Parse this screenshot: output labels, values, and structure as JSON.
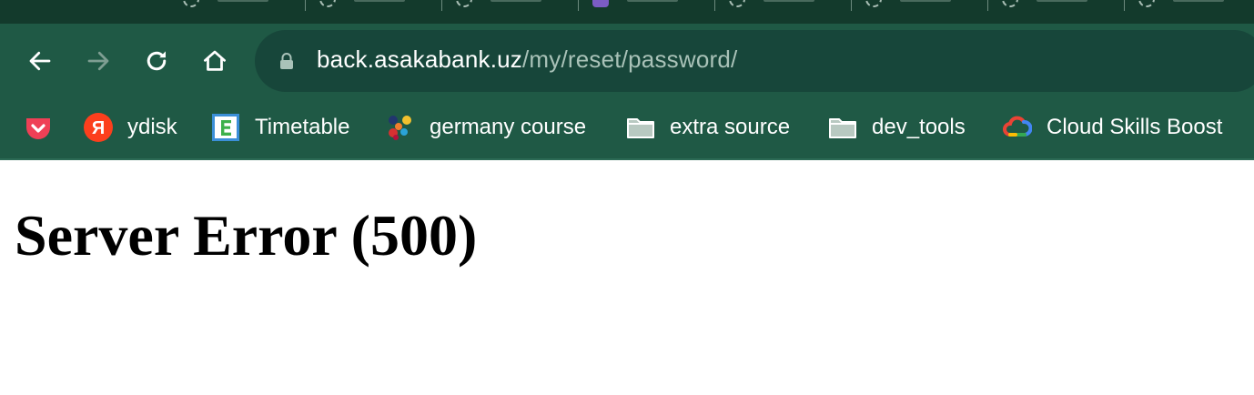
{
  "browser": {
    "tabs": [
      {
        "favicon": "loading-circle-icon"
      },
      {
        "favicon": "loading-circle-icon"
      },
      {
        "favicon": "loading-circle-icon"
      },
      {
        "favicon": "purple-app-icon"
      },
      {
        "favicon": "loading-circle-icon"
      },
      {
        "favicon": "loading-circle-icon"
      },
      {
        "favicon": "loading-circle-icon"
      },
      {
        "favicon": "loading-circle-icon"
      }
    ],
    "address": {
      "host": "back.asakabank.uz",
      "path": "/my/reset/password/"
    },
    "bookmarks": [
      {
        "label": "",
        "icon": "pocket-icon"
      },
      {
        "label": "ydisk",
        "icon": "yandex-icon"
      },
      {
        "label": "Timetable",
        "icon": "timetable-icon"
      },
      {
        "label": "germany course",
        "icon": "course-icon"
      },
      {
        "label": "extra source",
        "icon": "folder-icon"
      },
      {
        "label": "dev_tools",
        "icon": "folder-icon"
      },
      {
        "label": "Cloud Skills Boost",
        "icon": "google-cloud-icon"
      }
    ]
  },
  "page": {
    "heading": "Server Error (500)"
  },
  "colors": {
    "tabstrip": "#133a2c",
    "toolbar": "#1f5945",
    "omnibox": "#17463a",
    "url_path": "#a9c2b8"
  }
}
